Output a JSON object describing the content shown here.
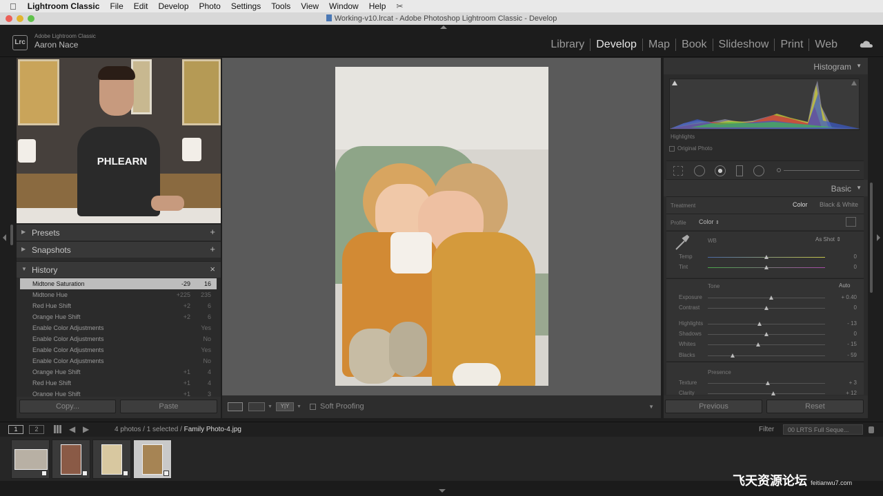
{
  "menubar": {
    "app_name": "Lightroom Classic",
    "items": [
      "File",
      "Edit",
      "Develop",
      "Photo",
      "Settings",
      "Tools",
      "View",
      "Window",
      "Help"
    ]
  },
  "window_title": "Working-v10.lrcat - Adobe Photoshop Lightroom Classic - Develop",
  "identity": {
    "product": "Adobe Lightroom Classic",
    "user": "Aaron Nace",
    "badge": "Lrc"
  },
  "modules": [
    "Library",
    "Develop",
    "Map",
    "Book",
    "Slideshow",
    "Print",
    "Web"
  ],
  "active_module": "Develop",
  "left_panel": {
    "video_shirt_text": "PHLEARN",
    "presets_label": "Presets",
    "snapshots_label": "Snapshots",
    "history_label": "History",
    "history": [
      {
        "name": "Midtone Saturation",
        "from": "-29",
        "to": "16"
      },
      {
        "name": "Midtone Hue",
        "from": "+225",
        "to": "235"
      },
      {
        "name": "Red Hue Shift",
        "from": "+2",
        "to": "6"
      },
      {
        "name": "Orange Hue Shift",
        "from": "+2",
        "to": "6"
      },
      {
        "name": "Enable Color Adjustments",
        "from": "",
        "to": "Yes"
      },
      {
        "name": "Enable Color Adjustments",
        "from": "",
        "to": "No"
      },
      {
        "name": "Enable Color Adjustments",
        "from": "",
        "to": "Yes"
      },
      {
        "name": "Enable Color Adjustments",
        "from": "",
        "to": "No"
      },
      {
        "name": "Orange Hue Shift",
        "from": "+1",
        "to": "4"
      },
      {
        "name": "Red Hue Shift",
        "from": "+1",
        "to": "4"
      },
      {
        "name": "Orange Hue Shift",
        "from": "+1",
        "to": "3"
      }
    ],
    "copy_label": "Copy...",
    "paste_label": "Paste"
  },
  "toolbar": {
    "soft_proofing_label": "Soft Proofing"
  },
  "right_panel": {
    "histogram_label": "Histogram",
    "highlights_label": "Highlights",
    "original_photo_label": "Original Photo",
    "basic_label": "Basic",
    "treatment_label": "Treatment",
    "treatment_color": "Color",
    "treatment_bw": "Black & White",
    "profile_label": "Profile",
    "profile_value": "Color",
    "wb_label": "WB",
    "wb_value": "As Shot",
    "tone_label": "Tone",
    "auto_label": "Auto",
    "presence_label": "Presence",
    "sliders": [
      {
        "name": "Temp",
        "value": "0",
        "level": 0.5
      },
      {
        "name": "Tint",
        "value": "0",
        "level": 0.5
      },
      {
        "name": "Exposure",
        "value": "+ 0.40",
        "level": 0.54
      },
      {
        "name": "Contrast",
        "value": "0",
        "level": 0.5
      },
      {
        "name": "Highlights",
        "value": "- 13",
        "level": 0.44
      },
      {
        "name": "Shadows",
        "value": "0",
        "level": 0.5
      },
      {
        "name": "Whites",
        "value": "- 15",
        "level": 0.43
      },
      {
        "name": "Blacks",
        "value": "- 59",
        "level": 0.21
      },
      {
        "name": "Texture",
        "value": "+ 3",
        "level": 0.51
      },
      {
        "name": "Clarity",
        "value": "+ 12",
        "level": 0.56
      }
    ],
    "previous_label": "Previous",
    "reset_label": "Reset"
  },
  "filmbar": {
    "page1": "1",
    "page2": "2",
    "count_text": "4 photos / 1 selected /",
    "filename": "Family Photo-4.jpg",
    "filter_label": "Filter",
    "filter_value": "00 LRTS Full Seque..."
  },
  "watermark": {
    "text": "飞天资源论坛",
    "url": "feitianwu7.com"
  },
  "colors": {
    "accent": "#e6e6e6",
    "panel": "#2b2b2b",
    "selected_row": "#bdbdbd"
  }
}
